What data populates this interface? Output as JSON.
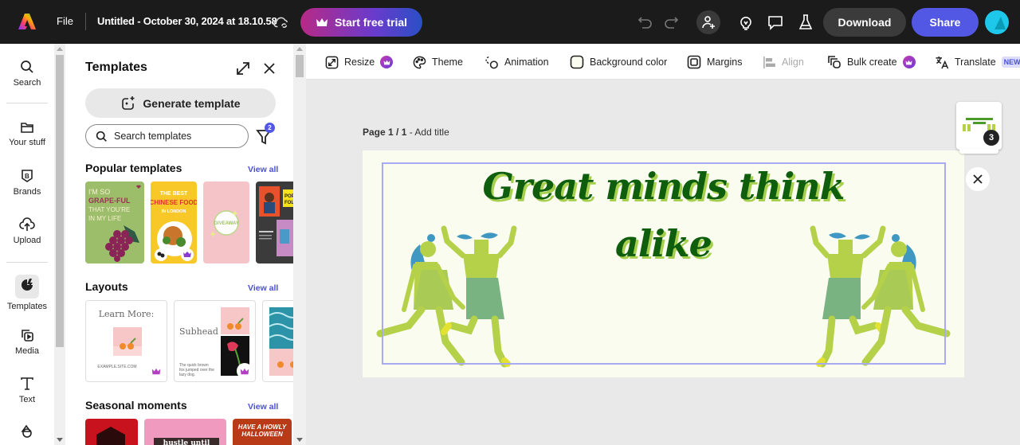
{
  "topbar": {
    "file_label": "File",
    "document_title": "Untitled - October 30, 2024 at 18.10.58",
    "trial_label": "Start free trial",
    "download_label": "Download",
    "share_label": "Share"
  },
  "rail": {
    "items": [
      {
        "label": "Search",
        "icon": "search-icon"
      },
      {
        "label": "Your stuff",
        "icon": "folder-icon"
      },
      {
        "label": "Brands",
        "icon": "brand-icon"
      },
      {
        "label": "Upload",
        "icon": "upload-icon"
      },
      {
        "label": "Templates",
        "icon": "templates-icon",
        "active": true
      },
      {
        "label": "Media",
        "icon": "media-icon"
      },
      {
        "label": "Text",
        "icon": "text-icon"
      },
      {
        "label": "",
        "icon": "elements-icon"
      }
    ]
  },
  "panel": {
    "title": "Templates",
    "generate_label": "Generate template",
    "search_placeholder": "Search templates",
    "filter_count": "2",
    "sections": [
      {
        "title": "Popular templates",
        "view_all": "View all",
        "cards": [
          "I'M SO GRAPE-FUL THAT YOU'RE IN MY LIFE",
          "THE BEST CHINESE FOOD IN LONDON",
          "GIVEAWAY",
          "POP FOLK"
        ]
      },
      {
        "title": "Layouts",
        "view_all": "View all",
        "cards": [
          "Learn More:",
          "Subhead",
          ""
        ],
        "card_details": {
          "site": "EXAMPLE.SITE.COM",
          "body": "The quick brown fox jumped over the lazy dog."
        }
      },
      {
        "title": "Seasonal moments",
        "view_all": "View all",
        "cards": [
          "",
          "hustle until your",
          "HAVE A HOWLY HALLOWEEN"
        ]
      }
    ]
  },
  "toolbar": {
    "items": [
      {
        "label": "Resize",
        "premium": true
      },
      {
        "label": "Theme"
      },
      {
        "label": "Animation"
      },
      {
        "label": "Background color"
      },
      {
        "label": "Margins"
      },
      {
        "label": "Align",
        "disabled": true
      },
      {
        "label": "Bulk create",
        "premium": true
      },
      {
        "label": "Translate",
        "tag": "NEW"
      }
    ]
  },
  "canvas": {
    "page_label": "Page 1 / 1",
    "page_title_placeholder": "- Add title",
    "headline_line1": "Great minds think",
    "headline_line2": "alike",
    "page_count": "3",
    "colors": {
      "background": "#fafcf0",
      "headline": "#0e5e0e",
      "headline_shadow": "#a6cf4e",
      "figure_body": "#b5d14a",
      "figure_skirt": "#7ab382",
      "figure_hair": "#3f98c1"
    }
  }
}
